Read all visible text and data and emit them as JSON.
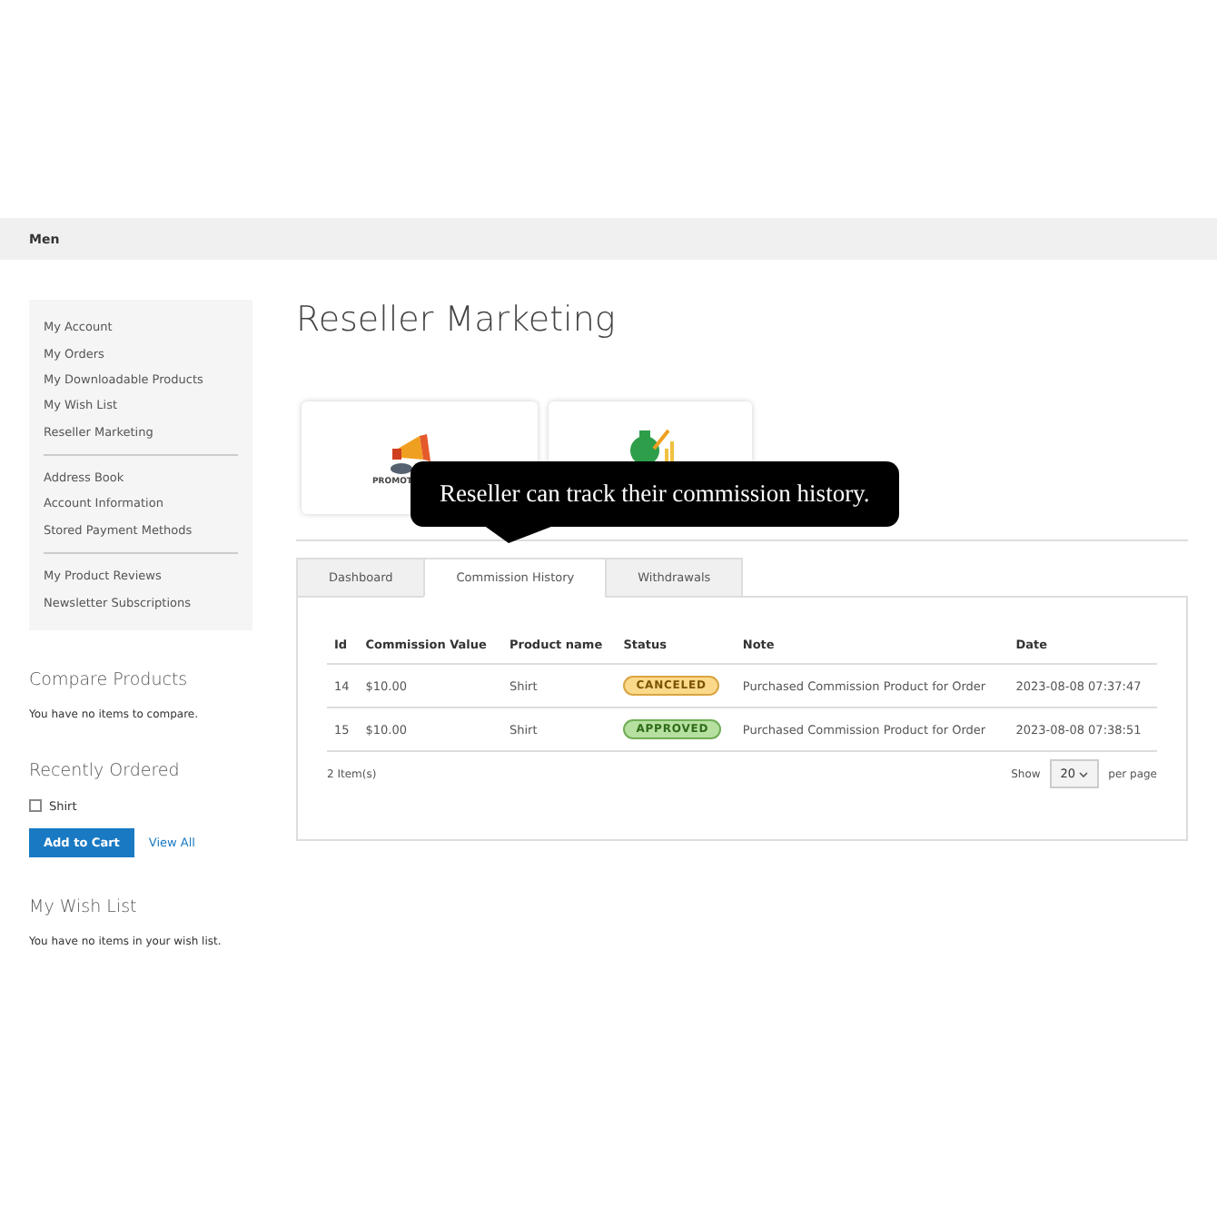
{
  "nav_bar": {
    "label": "Men"
  },
  "sidebar": {
    "groups": [
      [
        {
          "label": "My Account",
          "selected": false
        },
        {
          "label": "My Orders",
          "selected": false
        },
        {
          "label": "My Downloadable Products",
          "selected": false
        },
        {
          "label": "My Wish List",
          "selected": false
        },
        {
          "label": "Reseller Marketing",
          "selected": false
        }
      ],
      [
        {
          "label": "Address Book",
          "selected": false
        },
        {
          "label": "Account Information",
          "selected": false
        },
        {
          "label": "Stored Payment Methods",
          "selected": false
        }
      ],
      [
        {
          "label": "My Product Reviews",
          "selected": false
        },
        {
          "label": "Newsletter Subscriptions",
          "selected": false
        }
      ]
    ]
  },
  "compare": {
    "title": "Compare Products",
    "text": "You have no items to compare."
  },
  "recently_ordered": {
    "title": "Recently Ordered",
    "items": [
      {
        "label": "Shirt",
        "checked": false
      }
    ],
    "add_button": "Add to Cart",
    "view_all": "View All"
  },
  "wish_list": {
    "title": "My Wish List",
    "text": "You have no items in your wish list."
  },
  "page_title": "Reseller Marketing",
  "cards": [
    {
      "kind": "promotion",
      "label": "PROMOT"
    },
    {
      "kind": "money"
    }
  ],
  "tooltip": "Reseller can track their commission history.",
  "tabs": [
    {
      "label": "Dashboard",
      "selected": false
    },
    {
      "label": "Commission History",
      "selected": true
    },
    {
      "label": "Withdrawals",
      "selected": false
    }
  ],
  "table": {
    "columns": [
      "Id",
      "Commission Value",
      "Product name",
      "Status",
      "Note",
      "Date"
    ],
    "rows": [
      {
        "id": "14",
        "value": "$10.00",
        "product": "Shirt",
        "status": "CANCELED",
        "kind": "canceled",
        "note": "Purchased Commission Product for Order",
        "date": "2023-08-08 07:37:47"
      },
      {
        "id": "15",
        "value": "$10.00",
        "product": "Shirt",
        "status": "APPROVED",
        "kind": "approved",
        "note": "Purchased Commission Product for Order",
        "date": "2023-08-08 07:38:51"
      }
    ]
  },
  "footer": {
    "count": "2 Item(s)",
    "show": "Show",
    "per_page_value": "20",
    "per_page": "per page"
  }
}
